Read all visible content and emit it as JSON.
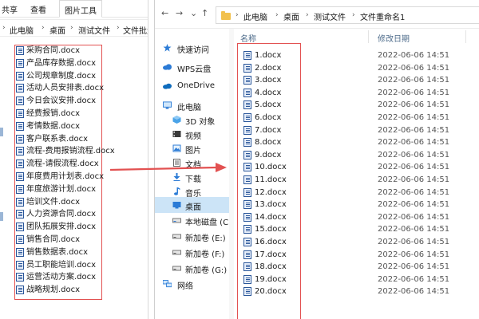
{
  "left_window": {
    "ribbon_tabs": [
      {
        "label": "共享",
        "active": false
      },
      {
        "label": "查看",
        "active": false
      },
      {
        "label": "图片工具",
        "active": true
      }
    ],
    "breadcrumb": [
      "此电脑",
      "桌面",
      "测试文件",
      "文件批量"
    ],
    "files": [
      "采购合同.docx",
      "产品库存数据.docx",
      "公司规章制度.docx",
      "活动人员安排表.docx",
      "今日会议安排.docx",
      "经费报销.docx",
      "考情数据.docx",
      "客户联系表.docx",
      "流程-费用报销流程.docx",
      "流程-请假流程.docx",
      "年度费用计划表.docx",
      "年度旅游计划.docx",
      "培训文件.docx",
      "人力资源合同.docx",
      "团队拓展安排.docx",
      "销售合同.docx",
      "销售数据表.docx",
      "员工职能培训.docx",
      "运营活动方案.docx",
      "战略规划.docx"
    ]
  },
  "right_window": {
    "nav_buttons": {
      "back": "←",
      "forward": "→",
      "dropdown": "⌄",
      "up": "↑"
    },
    "breadcrumb": [
      "此电脑",
      "桌面",
      "测试文件",
      "文件重命名1"
    ],
    "nav_items": [
      {
        "label": "快速访问",
        "icon": "star-icon",
        "selected": false
      },
      {
        "label": "WPS云盘",
        "icon": "cloud-icon",
        "selected": false
      },
      {
        "label": "OneDrive",
        "icon": "onedrive-icon",
        "selected": false
      },
      {
        "label": "此电脑",
        "icon": "computer-icon",
        "selected": false
      },
      {
        "label": "3D 对象",
        "icon": "cube-icon",
        "selected": false
      },
      {
        "label": "视频",
        "icon": "video-icon",
        "selected": false
      },
      {
        "label": "图片",
        "icon": "picture-icon",
        "selected": false
      },
      {
        "label": "文档",
        "icon": "document-icon",
        "selected": false
      },
      {
        "label": "下载",
        "icon": "download-icon",
        "selected": false
      },
      {
        "label": "音乐",
        "icon": "music-icon",
        "selected": false
      },
      {
        "label": "桌面",
        "icon": "desktop-icon",
        "selected": true
      },
      {
        "label": "本地磁盘 (C:)",
        "icon": "drive-icon",
        "selected": false
      },
      {
        "label": "新加卷 (E:)",
        "icon": "drive-icon",
        "selected": false
      },
      {
        "label": "新加卷 (F:)",
        "icon": "drive-icon",
        "selected": false
      },
      {
        "label": "新加卷 (G:)",
        "icon": "drive-icon",
        "selected": false
      },
      {
        "label": "网络",
        "icon": "network-icon",
        "selected": false
      }
    ],
    "columns": {
      "name": "名称",
      "date": "修改日期"
    },
    "files": [
      {
        "name": "1.docx",
        "date": "2022-06-06 14:51"
      },
      {
        "name": "2.docx",
        "date": "2022-06-06 14:51"
      },
      {
        "name": "3.docx",
        "date": "2022-06-06 14:51"
      },
      {
        "name": "4.docx",
        "date": "2022-06-06 14:51"
      },
      {
        "name": "5.docx",
        "date": "2022-06-06 14:51"
      },
      {
        "name": "6.docx",
        "date": "2022-06-06 14:51"
      },
      {
        "name": "7.docx",
        "date": "2022-06-06 14:51"
      },
      {
        "name": "8.docx",
        "date": "2022-06-06 14:51"
      },
      {
        "name": "9.docx",
        "date": "2022-06-06 14:51"
      },
      {
        "name": "10.docx",
        "date": "2022-06-06 14:51"
      },
      {
        "name": "11.docx",
        "date": "2022-06-06 14:51"
      },
      {
        "name": "12.docx",
        "date": "2022-06-06 14:51"
      },
      {
        "name": "13.docx",
        "date": "2022-06-06 14:51"
      },
      {
        "name": "14.docx",
        "date": "2022-06-06 14:51"
      },
      {
        "name": "15.docx",
        "date": "2022-06-06 14:51"
      },
      {
        "name": "16.docx",
        "date": "2022-06-06 14:51"
      },
      {
        "name": "17.docx",
        "date": "2022-06-06 14:51"
      },
      {
        "name": "18.docx",
        "date": "2022-06-06 14:51"
      },
      {
        "name": "19.docx",
        "date": "2022-06-06 14:51"
      },
      {
        "name": "20.docx",
        "date": "2022-06-06 14:51"
      }
    ]
  },
  "colors": {
    "highlight_border": "#e25151",
    "arrow": "#e25151",
    "selected_bg": "#cce4f7",
    "word_blue": "#2b579a"
  }
}
